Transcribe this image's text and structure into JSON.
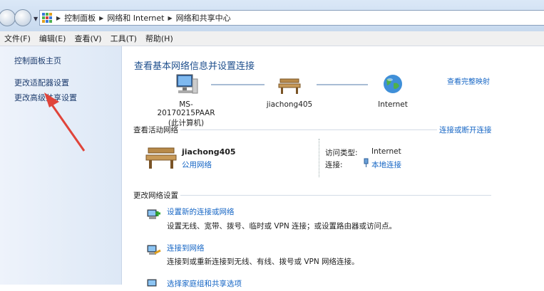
{
  "breadcrumb": [
    "控制面板",
    "网络和 Internet",
    "网络和共享中心"
  ],
  "menu": [
    "文件(F)",
    "编辑(E)",
    "查看(V)",
    "工具(T)",
    "帮助(H)"
  ],
  "sidebar": {
    "items": [
      {
        "label": "控制面板主页"
      },
      {
        "label": "更改适配器设置"
      },
      {
        "label": "更改高级共享设置"
      }
    ]
  },
  "main": {
    "title": "查看基本网络信息并设置连接",
    "full_map_link": "查看完整映射",
    "map": {
      "computer": {
        "name": "MS-20170215PAAR",
        "sub": "(此计算机)"
      },
      "network": {
        "name": "jiachong405"
      },
      "internet": {
        "name": "Internet"
      }
    },
    "active": {
      "header": "查看活动网络",
      "connect_link": "连接或断开连接",
      "network_name": "jiachong405",
      "network_category": "公用网络",
      "access_type_label": "访问类型:",
      "access_type_value": "Internet",
      "connection_label": "连接:",
      "connection_value": "本地连接"
    },
    "change": {
      "header": "更改网络设置",
      "tasks": [
        {
          "link": "设置新的连接或网络",
          "desc": "设置无线、宽带、拨号、临时或 VPN 连接；或设置路由器或访问点。"
        },
        {
          "link": "连接到网络",
          "desc": "连接到或重新连接到无线、有线、拨号或 VPN 网络连接。"
        },
        {
          "link": "选择家庭组和共享选项",
          "desc": ""
        }
      ]
    }
  },
  "colors": {
    "link": "#1666c5",
    "title": "#1e4f8d",
    "arrow": "#e0443a"
  }
}
